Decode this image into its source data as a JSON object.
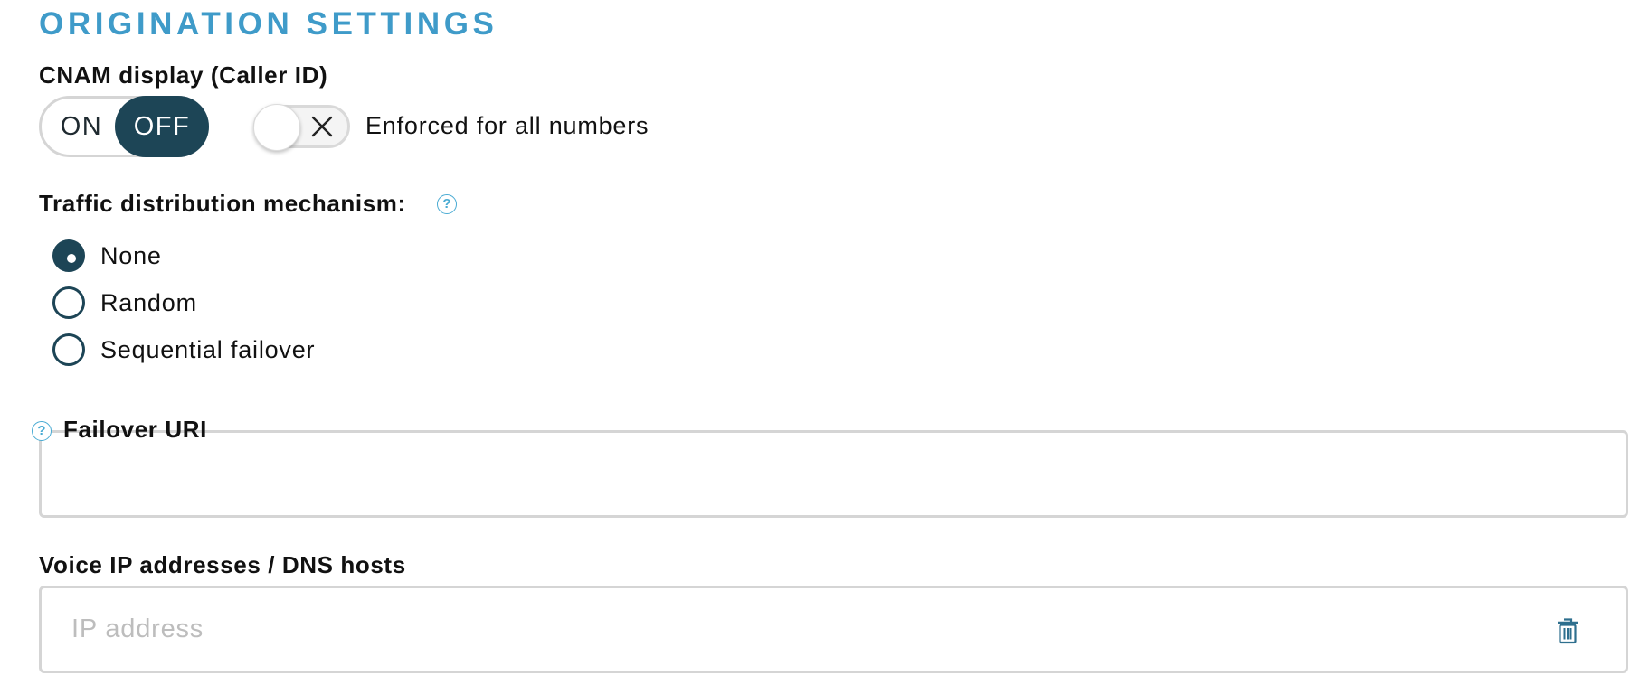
{
  "section": {
    "title": "ORIGINATION SETTINGS"
  },
  "cnam": {
    "label": "CNAM display (Caller ID)",
    "on_label": "ON",
    "off_label": "OFF",
    "selected": "OFF",
    "enforced_label": "Enforced for all numbers",
    "enforced_on": false
  },
  "traffic": {
    "label": "Traffic distribution mechanism:",
    "help_icon": "question-circle-icon",
    "options": [
      {
        "label": "None",
        "checked": true
      },
      {
        "label": "Random",
        "checked": false
      },
      {
        "label": "Sequential failover",
        "checked": false
      }
    ]
  },
  "failover": {
    "label": "Failover URI",
    "help_icon": "question-circle-icon",
    "value": ""
  },
  "voice_ip": {
    "label": "Voice IP addresses / DNS hosts",
    "placeholder": "IP address",
    "value": "",
    "delete_icon": "trash-icon"
  },
  "colors": {
    "accent": "#3f9bc9",
    "primary_dark": "#1d4556",
    "border": "#d5d5d5",
    "placeholder": "#bdbdbd"
  }
}
